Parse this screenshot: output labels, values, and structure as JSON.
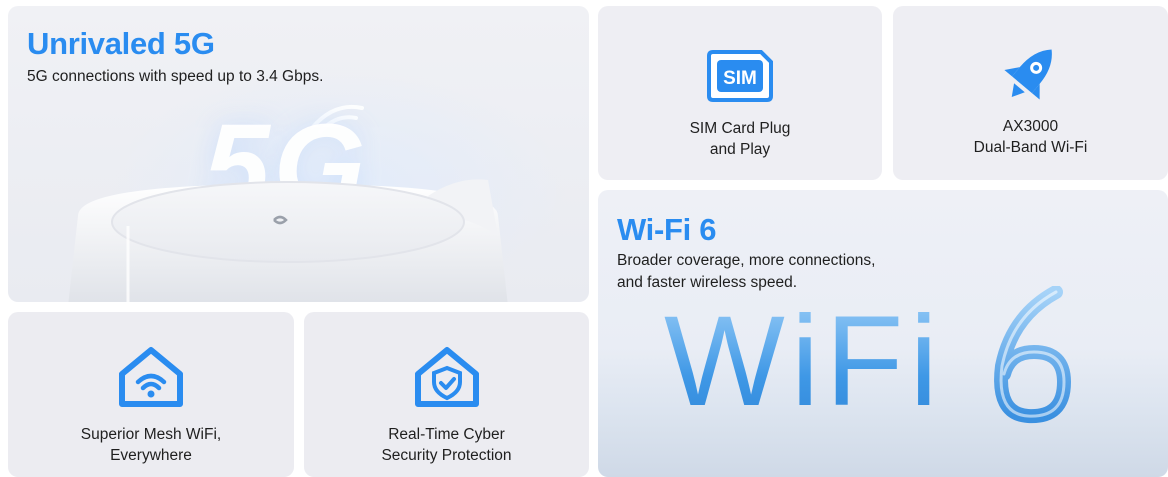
{
  "five_g": {
    "title": "Unrivaled 5G",
    "subtitle": "5G connections with speed up to 3.4 Gbps.",
    "graphic_text": "5G"
  },
  "features": {
    "sim": {
      "label": "SIM Card Plug\nand Play",
      "icon": "sim-card-icon",
      "icon_text": "SIM"
    },
    "ax": {
      "label": "AX3000\nDual-Band Wi-Fi",
      "icon": "rocket-icon"
    },
    "mesh": {
      "label": "Superior Mesh WiFi,\nEverywhere",
      "icon": "house-wifi-icon"
    },
    "cyber": {
      "label": "Real-Time Cyber\nSecurity Protection",
      "icon": "house-shield-icon"
    }
  },
  "wifi6": {
    "title": "Wi-Fi 6",
    "subtitle_line1": "Broader coverage, more connections,",
    "subtitle_line2": "and faster wireless speed.",
    "graphic_text": "WiFi"
  },
  "colors": {
    "accent": "#2a8cf0",
    "card_bg": "#eeeef3"
  }
}
